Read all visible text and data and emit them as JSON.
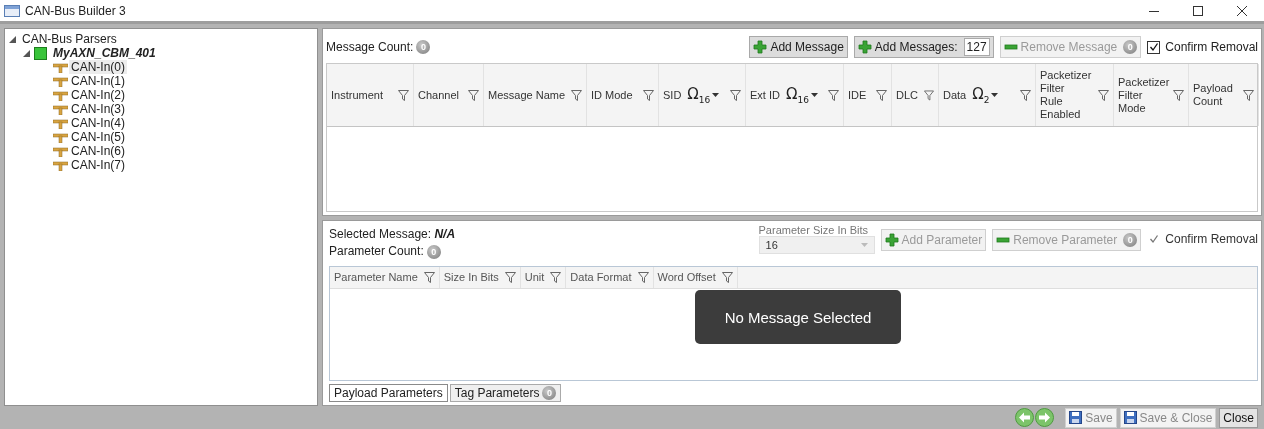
{
  "window": {
    "title": "CAN-Bus Builder 3"
  },
  "tree": {
    "label": "CAN-Bus Parsers",
    "expanded": true,
    "children": [
      {
        "label": "MyAXN_CBM_401",
        "expanded": true,
        "children": [
          {
            "label": "CAN-In(0)",
            "selected": true
          },
          {
            "label": "CAN-In(1)",
            "selected": false
          },
          {
            "label": "CAN-In(2)",
            "selected": false
          },
          {
            "label": "CAN-In(3)",
            "selected": false
          },
          {
            "label": "CAN-In(4)",
            "selected": false
          },
          {
            "label": "CAN-In(5)",
            "selected": false
          },
          {
            "label": "CAN-In(6)",
            "selected": false
          },
          {
            "label": "CAN-In(7)",
            "selected": false
          }
        ]
      }
    ]
  },
  "messages": {
    "count_label": "Message Count:",
    "count": "0",
    "buttons": [
      {
        "label": "Add Message",
        "kind": "add",
        "disabled": false
      },
      {
        "label": "Add Messages:",
        "kind": "add",
        "disabled": false,
        "value": "127"
      },
      {
        "label": "Remove Message",
        "kind": "remove",
        "disabled": true,
        "badge": "0"
      }
    ],
    "confirm": {
      "label": "Confirm Removal",
      "checked": true,
      "disabled": false
    },
    "columns": [
      {
        "label": "Instrument"
      },
      {
        "label": "Channel"
      },
      {
        "label": "Message Name"
      },
      {
        "label": "ID Mode"
      },
      {
        "label": "SID",
        "radix": "Ω$_{16}$"
      },
      {
        "label": "Ext ID",
        "radix": "Ω$_{16}$"
      },
      {
        "label": "IDE"
      },
      {
        "label": "DLC"
      },
      {
        "label": "Data",
        "radix": "Ω$_{2}$"
      },
      {
        "label": "Packetizer Filter Rule Enabled"
      },
      {
        "label": "Packetizer Filter Mode"
      },
      {
        "label": "Payload Count"
      }
    ]
  },
  "parameters": {
    "selected_label": "Selected Message:",
    "selected_value": "N/A",
    "count_label": "Parameter Count:",
    "count": "0",
    "size": {
      "label": "Parameter Size In Bits",
      "value": "16",
      "disabled": true
    },
    "buttons": [
      {
        "label": "Add Parameter",
        "kind": "add",
        "disabled": true
      },
      {
        "label": "Remove Parameter",
        "kind": "remove",
        "disabled": true,
        "badge": "0"
      }
    ],
    "confirm": {
      "label": "Confirm Removal",
      "checked": true,
      "disabled": true
    },
    "columns": [
      {
        "label": "Parameter Name"
      },
      {
        "label": "Size In Bits"
      },
      {
        "label": "Unit"
      },
      {
        "label": "Data Format"
      },
      {
        "label": "Word Offset"
      }
    ],
    "overlay": "No Message Selected",
    "tabs": [
      {
        "label": "Payload Parameters",
        "selected": true
      },
      {
        "label": "Tag Parameters",
        "selected": false,
        "badge": "0"
      }
    ]
  },
  "footer": {
    "buttons": [
      {
        "label": "Save",
        "kind": "save",
        "disabled": true
      },
      {
        "label": "Save & Close",
        "kind": "save",
        "disabled": true
      },
      {
        "label": "Close",
        "kind": "plain",
        "disabled": false
      }
    ]
  }
}
